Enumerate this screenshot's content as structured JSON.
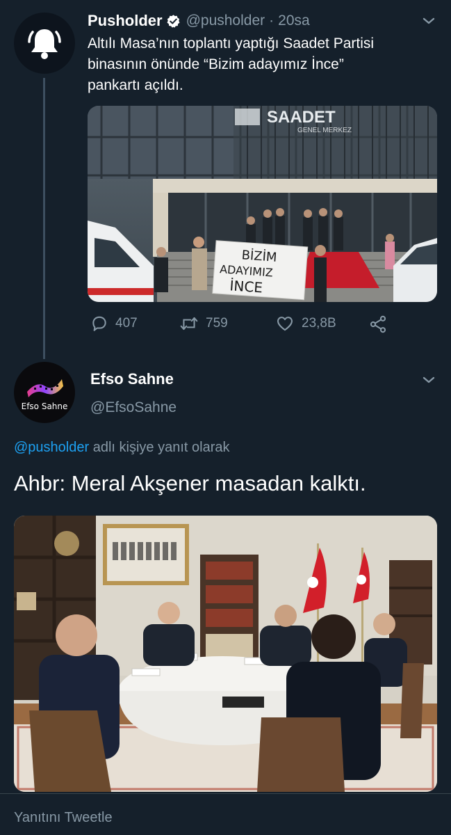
{
  "tweet1": {
    "name": "Pusholder",
    "handle": "@pusholder",
    "separator": "·",
    "time": "20sa",
    "text_lines": [
      "Altılı Masa’nın toplantı yaptığı Saadet Partisi",
      "binasının önünde “Bizim adayımız İnce”",
      "pankartı açıldı."
    ],
    "photo": {
      "building_sign": "SAADET",
      "building_subsign": "GENEL MERKEZ",
      "banner_lines": [
        "BİZİM",
        "ADAYIMIZ",
        "İNCE"
      ]
    },
    "actions": {
      "replies": "407",
      "retweets": "759",
      "likes": "23,8B"
    },
    "icons": {
      "avatar": "bell-icon",
      "verified": "verified-badge-icon",
      "menu": "chevron-down-icon",
      "reply": "reply-icon",
      "retweet": "retweet-icon",
      "like": "heart-icon",
      "share": "share-icon"
    }
  },
  "tweet2": {
    "name": "Efso Sahne",
    "handle": "@EfsoSahne",
    "avatar_text": "Efso Sahne",
    "reply_mention": "@pusholder",
    "reply_suffix": " adlı kişiye yanıt olarak",
    "text": "Ahbr: Meral Akşener masadan kalktı."
  },
  "reply_bar": {
    "placeholder": "Yanıtını Tweetle"
  },
  "colors": {
    "background": "#15202b",
    "secondary_text": "#8899a6",
    "accent": "#1da1f2",
    "divider": "#38444d"
  }
}
